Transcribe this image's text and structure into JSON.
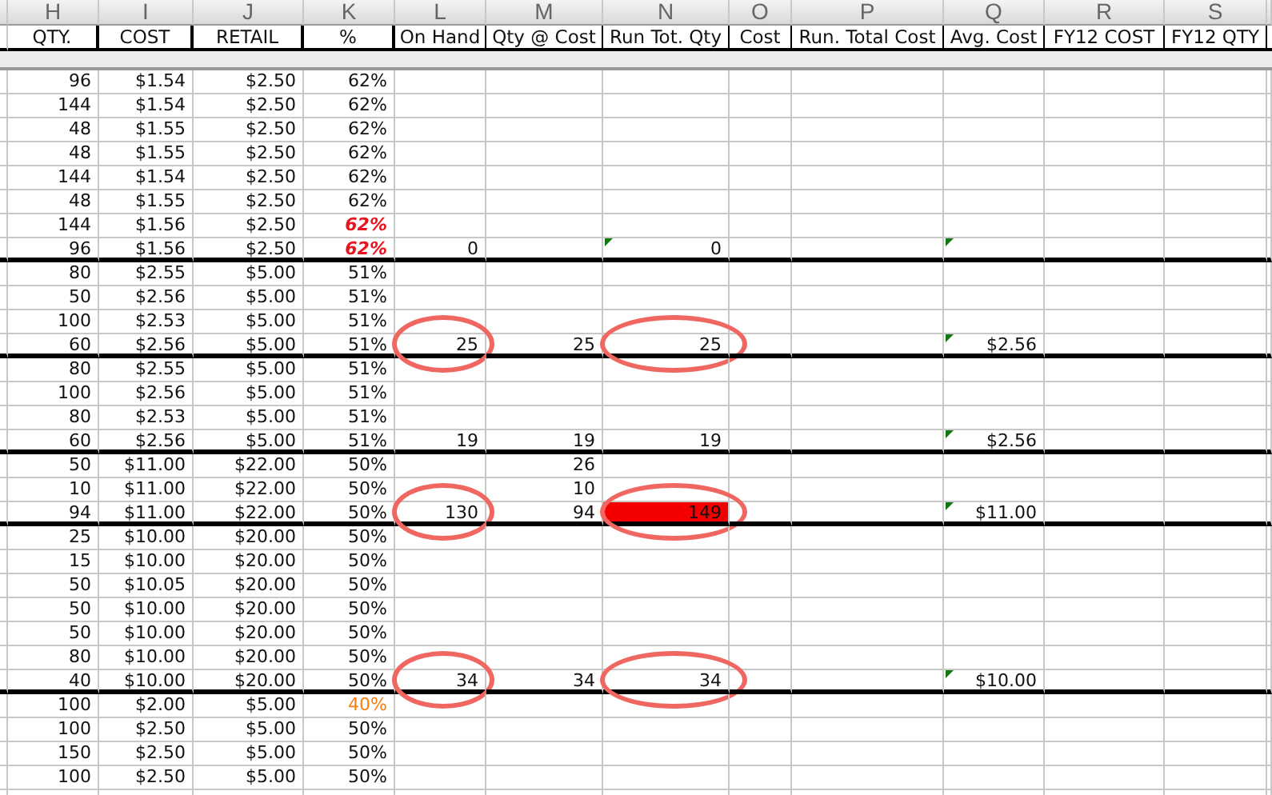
{
  "column_letters": [
    "H",
    "I",
    "J",
    "K",
    "L",
    "M",
    "N",
    "O",
    "P",
    "Q",
    "R",
    "S"
  ],
  "headers": [
    "QTY.",
    "COST",
    "RETAIL",
    "%",
    "On Hand",
    "Qty @ Cost",
    "Run Tot. Qty",
    "Cost",
    "Run. Total Cost",
    "Avg. Cost",
    "FY12 COST",
    "FY12 QTY"
  ],
  "rows": [
    {
      "qty": "96",
      "cost": "$1.54",
      "retail": "$2.50",
      "pct": "62%",
      "pct_alert": false,
      "pct_warning": false,
      "group_end": false,
      "circled": false,
      "run_tot_highlight": false,
      "flag_n": false,
      "flag_q": false
    },
    {
      "qty": "144",
      "cost": "$1.54",
      "retail": "$2.50",
      "pct": "62%",
      "pct_alert": false,
      "pct_warning": false,
      "group_end": false,
      "circled": false,
      "run_tot_highlight": false,
      "flag_n": false,
      "flag_q": false
    },
    {
      "qty": "48",
      "cost": "$1.55",
      "retail": "$2.50",
      "pct": "62%",
      "pct_alert": false,
      "pct_warning": false,
      "group_end": false,
      "circled": false,
      "run_tot_highlight": false,
      "flag_n": false,
      "flag_q": false
    },
    {
      "qty": "48",
      "cost": "$1.55",
      "retail": "$2.50",
      "pct": "62%",
      "pct_alert": false,
      "pct_warning": false,
      "group_end": false,
      "circled": false,
      "run_tot_highlight": false,
      "flag_n": false,
      "flag_q": false
    },
    {
      "qty": "144",
      "cost": "$1.54",
      "retail": "$2.50",
      "pct": "62%",
      "pct_alert": false,
      "pct_warning": false,
      "group_end": false,
      "circled": false,
      "run_tot_highlight": false,
      "flag_n": false,
      "flag_q": false
    },
    {
      "qty": "48",
      "cost": "$1.55",
      "retail": "$2.50",
      "pct": "62%",
      "pct_alert": false,
      "pct_warning": false,
      "group_end": false,
      "circled": false,
      "run_tot_highlight": false,
      "flag_n": false,
      "flag_q": false
    },
    {
      "qty": "144",
      "cost": "$1.56",
      "retail": "$2.50",
      "pct": "62%",
      "pct_alert": true,
      "pct_warning": false,
      "group_end": false,
      "circled": false,
      "run_tot_highlight": false,
      "flag_n": false,
      "flag_q": false
    },
    {
      "qty": "96",
      "cost": "$1.56",
      "retail": "$2.50",
      "pct": "62%",
      "pct_alert": true,
      "pct_warning": false,
      "on_hand": "0",
      "run_tot_qty": "0",
      "group_end": true,
      "circled": false,
      "run_tot_highlight": false,
      "flag_n": true,
      "flag_q": true
    },
    {
      "qty": "80",
      "cost": "$2.55",
      "retail": "$5.00",
      "pct": "51%",
      "pct_alert": false,
      "pct_warning": false,
      "group_end": false,
      "circled": false,
      "run_tot_highlight": false,
      "flag_n": false,
      "flag_q": false
    },
    {
      "qty": "50",
      "cost": "$2.56",
      "retail": "$5.00",
      "pct": "51%",
      "pct_alert": false,
      "pct_warning": false,
      "group_end": false,
      "circled": false,
      "run_tot_highlight": false,
      "flag_n": false,
      "flag_q": false
    },
    {
      "qty": "100",
      "cost": "$2.53",
      "retail": "$5.00",
      "pct": "51%",
      "pct_alert": false,
      "pct_warning": false,
      "group_end": false,
      "circled": false,
      "run_tot_highlight": false,
      "flag_n": false,
      "flag_q": false
    },
    {
      "qty": "60",
      "cost": "$2.56",
      "retail": "$5.00",
      "pct": "51%",
      "pct_alert": false,
      "pct_warning": false,
      "on_hand": "25",
      "qty_at_cost": "25",
      "run_tot_qty": "25",
      "avg_cost": "$2.56",
      "group_end": true,
      "circled": true,
      "run_tot_highlight": false,
      "flag_n": false,
      "flag_q": true
    },
    {
      "qty": "80",
      "cost": "$2.55",
      "retail": "$5.00",
      "pct": "51%",
      "pct_alert": false,
      "pct_warning": false,
      "group_end": false,
      "circled": false,
      "run_tot_highlight": false,
      "flag_n": false,
      "flag_q": false
    },
    {
      "qty": "100",
      "cost": "$2.56",
      "retail": "$5.00",
      "pct": "51%",
      "pct_alert": false,
      "pct_warning": false,
      "group_end": false,
      "circled": false,
      "run_tot_highlight": false,
      "flag_n": false,
      "flag_q": false
    },
    {
      "qty": "80",
      "cost": "$2.53",
      "retail": "$5.00",
      "pct": "51%",
      "pct_alert": false,
      "pct_warning": false,
      "group_end": false,
      "circled": false,
      "run_tot_highlight": false,
      "flag_n": false,
      "flag_q": false
    },
    {
      "qty": "60",
      "cost": "$2.56",
      "retail": "$5.00",
      "pct": "51%",
      "pct_alert": false,
      "pct_warning": false,
      "on_hand": "19",
      "qty_at_cost": "19",
      "run_tot_qty": "19",
      "avg_cost": "$2.56",
      "group_end": true,
      "circled": false,
      "run_tot_highlight": false,
      "flag_n": false,
      "flag_q": true
    },
    {
      "qty": "50",
      "cost": "$11.00",
      "retail": "$22.00",
      "pct": "50%",
      "pct_alert": false,
      "pct_warning": false,
      "qty_at_cost": "26",
      "group_end": false,
      "circled": false,
      "run_tot_highlight": false,
      "flag_n": false,
      "flag_q": false
    },
    {
      "qty": "10",
      "cost": "$11.00",
      "retail": "$22.00",
      "pct": "50%",
      "pct_alert": false,
      "pct_warning": false,
      "qty_at_cost": "10",
      "group_end": false,
      "circled": false,
      "run_tot_highlight": false,
      "flag_n": false,
      "flag_q": false
    },
    {
      "qty": "94",
      "cost": "$11.00",
      "retail": "$22.00",
      "pct": "50%",
      "pct_alert": false,
      "pct_warning": false,
      "on_hand": "130",
      "qty_at_cost": "94",
      "run_tot_qty": "149",
      "avg_cost": "$11.00",
      "group_end": true,
      "circled": true,
      "run_tot_highlight": true,
      "flag_n": false,
      "flag_q": true
    },
    {
      "qty": "25",
      "cost": "$10.00",
      "retail": "$20.00",
      "pct": "50%",
      "pct_alert": false,
      "pct_warning": false,
      "group_end": false,
      "circled": false,
      "run_tot_highlight": false,
      "flag_n": false,
      "flag_q": false
    },
    {
      "qty": "15",
      "cost": "$10.00",
      "retail": "$20.00",
      "pct": "50%",
      "pct_alert": false,
      "pct_warning": false,
      "group_end": false,
      "circled": false,
      "run_tot_highlight": false,
      "flag_n": false,
      "flag_q": false
    },
    {
      "qty": "50",
      "cost": "$10.05",
      "retail": "$20.00",
      "pct": "50%",
      "pct_alert": false,
      "pct_warning": false,
      "group_end": false,
      "circled": false,
      "run_tot_highlight": false,
      "flag_n": false,
      "flag_q": false
    },
    {
      "qty": "50",
      "cost": "$10.00",
      "retail": "$20.00",
      "pct": "50%",
      "pct_alert": false,
      "pct_warning": false,
      "group_end": false,
      "circled": false,
      "run_tot_highlight": false,
      "flag_n": false,
      "flag_q": false
    },
    {
      "qty": "50",
      "cost": "$10.00",
      "retail": "$20.00",
      "pct": "50%",
      "pct_alert": false,
      "pct_warning": false,
      "group_end": false,
      "circled": false,
      "run_tot_highlight": false,
      "flag_n": false,
      "flag_q": false
    },
    {
      "qty": "80",
      "cost": "$10.00",
      "retail": "$20.00",
      "pct": "50%",
      "pct_alert": false,
      "pct_warning": false,
      "group_end": false,
      "circled": false,
      "run_tot_highlight": false,
      "flag_n": false,
      "flag_q": false
    },
    {
      "qty": "40",
      "cost": "$10.00",
      "retail": "$20.00",
      "pct": "50%",
      "pct_alert": false,
      "pct_warning": false,
      "on_hand": "34",
      "qty_at_cost": "34",
      "run_tot_qty": "34",
      "avg_cost": "$10.00",
      "group_end": true,
      "circled": true,
      "run_tot_highlight": false,
      "flag_n": false,
      "flag_q": true
    },
    {
      "qty": "100",
      "cost": "$2.00",
      "retail": "$5.00",
      "pct": "40%",
      "pct_alert": false,
      "pct_warning": true,
      "group_end": false,
      "circled": false,
      "run_tot_highlight": false,
      "flag_n": false,
      "flag_q": false
    },
    {
      "qty": "100",
      "cost": "$2.50",
      "retail": "$5.00",
      "pct": "50%",
      "pct_alert": false,
      "pct_warning": false,
      "group_end": false,
      "circled": false,
      "run_tot_highlight": false,
      "flag_n": false,
      "flag_q": false
    },
    {
      "qty": "150",
      "cost": "$2.50",
      "retail": "$5.00",
      "pct": "50%",
      "pct_alert": false,
      "pct_warning": false,
      "group_end": false,
      "circled": false,
      "run_tot_highlight": false,
      "flag_n": false,
      "flag_q": false
    },
    {
      "qty": "100",
      "cost": "$2.50",
      "retail": "$5.00",
      "pct": "50%",
      "pct_alert": false,
      "pct_warning": false,
      "group_end": false,
      "circled": false,
      "run_tot_highlight": false,
      "flag_n": false,
      "flag_q": false
    }
  ]
}
